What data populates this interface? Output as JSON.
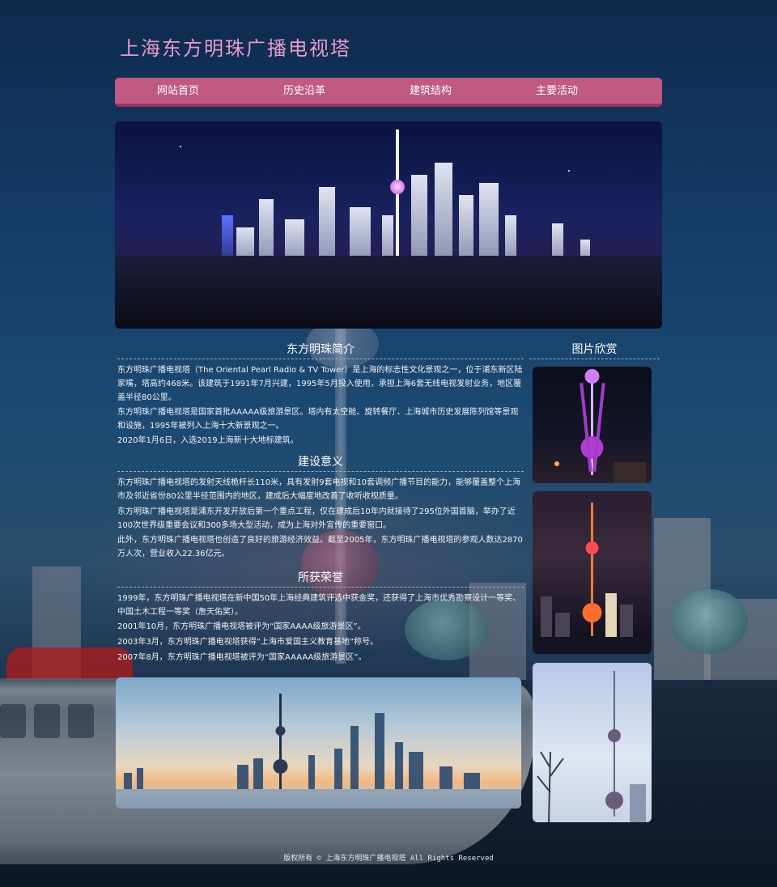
{
  "site": {
    "title": "上海东方明珠广播电视塔"
  },
  "nav": {
    "items": [
      {
        "label": "网站首页"
      },
      {
        "label": "历史沿革"
      },
      {
        "label": "建筑结构"
      },
      {
        "label": "主要活动"
      }
    ]
  },
  "intro": {
    "title": "东方明珠简介",
    "paragraphs": [
      "东方明珠广播电视塔（The Oriental Pearl Radio & TV Tower）是上海的标志性文化景观之一，位于浦东新区陆家嘴，塔高约468米。该建筑于1991年7月兴建，1995年5月投入使用，承担上海6套无线电视发射业务，地区覆盖半径80公里。",
      "东方明珠广播电视塔是国家首批AAAAA级旅游景区。塔内有太空舱、旋转餐厅、上海城市历史发展陈列馆等景观和设施，1995年被列入上海十大新景观之一。",
      "2020年1月6日，入选2019上海新十大地标建筑。"
    ]
  },
  "significance": {
    "title": "建设意义",
    "paragraphs": [
      "东方明珠广播电视塔的发射天线桅杆长110米，具有发射9套电视和10套调频广播节目的能力，能够覆盖整个上海市及邻近省份80公里半径范围内的地区，建成后大幅度地改善了收听收视质量。",
      "东方明珠广播电视塔是浦东开发开放后第一个重点工程，仅在建成后10年内就接待了295位外国首脑，举办了近100次世界级重要会议和300多场大型活动，成为上海对外宣传的重要窗口。",
      "此外，东方明珠广播电视塔也创造了良好的旅游经济效益。截至2005年，东方明珠广播电视塔的参观人数达2870万人次，营业收入22.36亿元。"
    ]
  },
  "honors": {
    "title": "所获荣誉",
    "paragraphs": [
      "1999年，东方明珠广播电视塔在新中国50年上海经典建筑评选中获金奖，还获得了上海市优秀勘察设计一等奖、中国土木工程一等奖（詹天佑奖）。",
      "2001年10月，东方明珠广播电视塔被评为“国家AAAA级旅游景区”。",
      "2003年3月，东方明珠广播电视塔获得“上海市爱国主义教育基地”称号。",
      "2007年8月，东方明珠广播电视塔被评为“国家AAAAA级旅游景区”。"
    ]
  },
  "gallery": {
    "title": "图片欣赏"
  },
  "footer": {
    "text": "版权所有 © 上海东方明珠广播电视塔 All Rights Reserved"
  },
  "colors": {
    "nav": "#c05a82",
    "title": "#e89ad0"
  }
}
